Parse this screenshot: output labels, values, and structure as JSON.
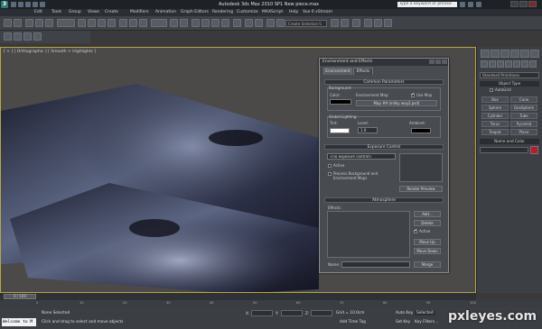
{
  "app": {
    "title": "Autodesk 3ds Max  2010 SP1      New piece.max",
    "search_placeholder": "Type a keyword or phrase",
    "logo_letter": "3"
  },
  "menu": [
    "Edit",
    "Tools",
    "Group",
    "Views",
    "Create",
    "Modifiers",
    "Animation",
    "Graph Editors",
    "Rendering",
    "Customize",
    "MAXScript",
    "Help",
    "Vue 6 xStream"
  ],
  "toolbar": {
    "selection_set_placeholder": "Create Selection S"
  },
  "viewport": {
    "label": "[ + ] [ Orthographic ] [ Smooth + Highlights ]"
  },
  "command_panel": {
    "category": "Standard Primitives",
    "object_type_header": "Object Type",
    "autogrid_label": "AutoGrid",
    "objects": [
      "Box",
      "Cone",
      "Sphere",
      "GeoSphere",
      "Cylinder",
      "Tube",
      "Torus",
      "Pyramid",
      "Teapot",
      "Plane"
    ],
    "name_color_header": "Name and Color",
    "object_color": "#b81830"
  },
  "dialog": {
    "title": "Environment and Effects",
    "tabs": [
      "Environment",
      "Effects"
    ],
    "common_parameters": {
      "header": "Common Parameters",
      "background_label": "Background:",
      "color_label": "Color:",
      "env_map_label": "Environment Map:",
      "use_map_label": "Use Map",
      "use_map_checked": true,
      "map_button": "Map #9 (milky way2.psd)",
      "global_lighting_label": "Global Lighting:",
      "tint_label": "Tint:",
      "level_label": "Level:",
      "level_value": "1.0",
      "ambient_label": "Ambient:",
      "background_color": "#000000",
      "tint_color": "#ffffff",
      "ambient_color": "#000000"
    },
    "exposure_control": {
      "header": "Exposure Control",
      "dropdown": "<no exposure control>",
      "active_label": "Active",
      "process_bg_label": "Process Background and Environment Maps",
      "render_preview": "Render Preview"
    },
    "atmosphere": {
      "header": "Atmosphere",
      "effects_label": "Effects:",
      "buttons": [
        "Add...",
        "Delete",
        "Active",
        "Move Up",
        "Move Down",
        "Merge"
      ],
      "active_checked": true,
      "name_label": "Name:"
    }
  },
  "timeline": {
    "frame_display": "0 / 100",
    "ticks": [
      "0",
      "10",
      "20",
      "30",
      "40",
      "50",
      "60",
      "70",
      "80",
      "90",
      "100"
    ]
  },
  "status": {
    "maxscript_text": "Welcome to M",
    "selection_status": "None Selected",
    "prompt": "Click and drag to select and move objects",
    "x_label": "X:",
    "y_label": "Y:",
    "z_label": "Z:",
    "grid": "Grid = 10.0cm",
    "add_time_tag": "Add Time Tag",
    "auto_key": "Auto Key",
    "set_key": "Set Key",
    "selected": "Selected",
    "key_filters": "Key Filters..."
  },
  "watermark": "pxleyes.com"
}
